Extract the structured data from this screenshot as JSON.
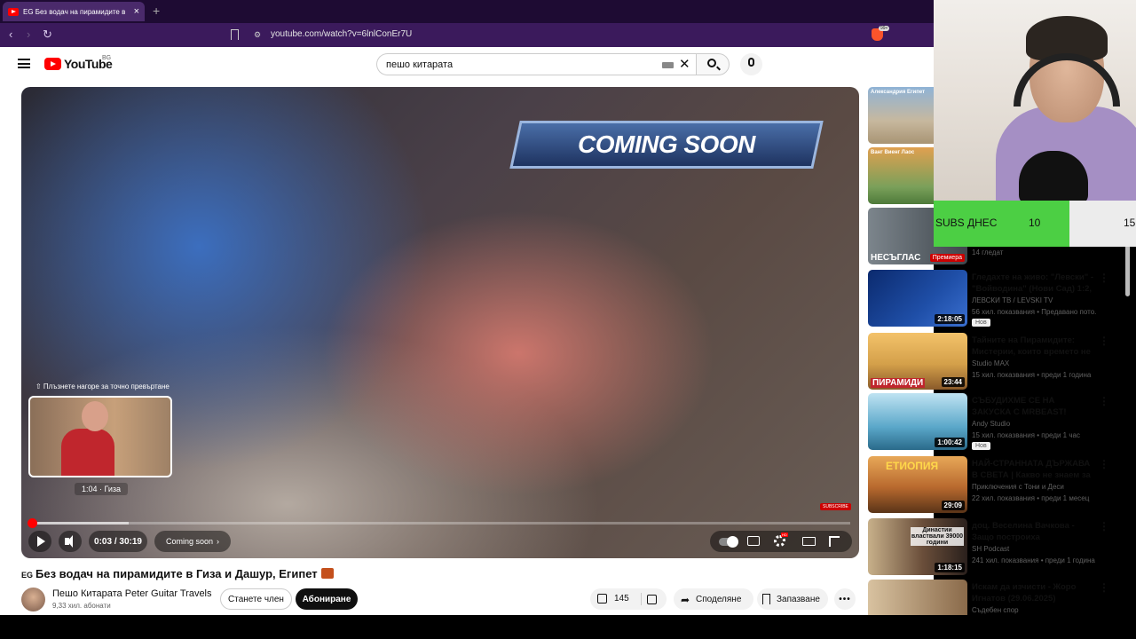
{
  "browser": {
    "tab_title": "EG Без водач на пирамидите в",
    "url": "youtube.com/watch?v=6lnlConEr7U",
    "brave_badge": "99+"
  },
  "header": {
    "logo_text": "YouTube",
    "country_code": "BG",
    "search_value": "пешо китарата"
  },
  "player": {
    "overlay_banner": "COMING SOON",
    "scrub_hint": "⇧ Плъзнете нагоре за точно превъртане",
    "preview_time": "1:04 · Гиза",
    "time_display": "0:03 / 30:19",
    "chapter_label": "Coming soon",
    "watermark": "SUBSCRIBE",
    "played_fraction": 0.002,
    "loaded_fraction": 0.12,
    "hd_badge": "HD"
  },
  "video": {
    "flag_prefix": "EG",
    "title": "Без водач на пирамидите в Гиза и Дашур, Египет",
    "channel_name": "Пешо Китарата Peter Guitar Travels",
    "subscribers": "9,33 хил. абонати",
    "join_label": "Станете член",
    "subscribe_label": "Абониране",
    "likes": "145",
    "share_label": "Споделяне",
    "save_label": "Запазване",
    "more_label": "•••"
  },
  "recommendations": [
    {
      "thumb_text": "Александрия Египет",
      "title": "",
      "channel": "",
      "meta": "",
      "duration": "",
      "badge": "",
      "thumb_color": "#c7b89e"
    },
    {
      "thumb_text": "Ванг Виенг Лаос",
      "title": "",
      "channel": "",
      "meta": "",
      "duration": "",
      "badge": "",
      "thumb_color": "#d98b4a"
    },
    {
      "thumb_text": "НЕСЪГЛАС",
      "title": "",
      "channel": "",
      "meta": "14 гледат",
      "duration": "",
      "badge": "",
      "thumb_color": "#5f6a72",
      "premiere": "Премиера"
    },
    {
      "thumb_text": "",
      "title": "Гледахте на живо: \"Левски\" - \"Войводина\" (Нови Сад) 1:2, ...",
      "channel": "ЛЕВСКИ ТВ / LEVSKI TV",
      "meta": "56 хил. показвания • Предавано пото...",
      "duration": "2:18:05",
      "badge": "Нов",
      "thumb_color": "#1f4fa8"
    },
    {
      "thumb_text": "ПИРАМИДИ",
      "title": "Тайните на Пирамидите: Мистерии, които времето не ...",
      "channel": "Studio MAX",
      "meta": "15 хил. показвания • преди 1 година",
      "duration": "23:44",
      "badge": "",
      "thumb_color": "#d4a04a"
    },
    {
      "thumb_text": "",
      "title": "СЪБУДИХМЕ СЕ НА ЗАКУСКА С MRBEAST!",
      "channel": "Andy Studio",
      "meta": "15 хил. показвания • преди 1 час",
      "duration": "1:00:42",
      "badge": "Нов",
      "thumb_color": "#5aa7c9"
    },
    {
      "thumb_text": "ЕТИОПИЯ",
      "title": "НАЙ-СТРАННАТА ДЪРЖАВА В СВЕТА | Какво не знаем за ...",
      "channel": "Приключения с Тони и Деси",
      "meta": "22 хил. показвания • преди 1 месец",
      "duration": "29:09",
      "badge": "",
      "thumb_color": "#b8692e"
    },
    {
      "thumb_text": "Династии властвали 39000 години",
      "title": "доц. Веселина Вачкова - Защо построиха пирамидите? | Th...",
      "channel": "SH Podcast",
      "meta": "241 хил. показвания • преди 1 година",
      "duration": "1:18:15",
      "badge": "",
      "thumb_color": "#3a2e2a"
    },
    {
      "thumb_text": "",
      "title": "Искам да изчисти - Жоро Игнатов (29.06.2025)",
      "channel": "Съдебен спор",
      "meta": "",
      "duration": "",
      "badge": "",
      "thumb_color": "#8a6a4a"
    }
  ],
  "overlay": {
    "subs_label": "SUBS ДНЕС",
    "subs_current": "10",
    "subs_goal": "15",
    "subs_progress_fraction": 0.67
  },
  "colors": {
    "browser_bg": "#1e0b33",
    "youtube_red": "#ff0000",
    "subs_green": "#4ccf44"
  }
}
